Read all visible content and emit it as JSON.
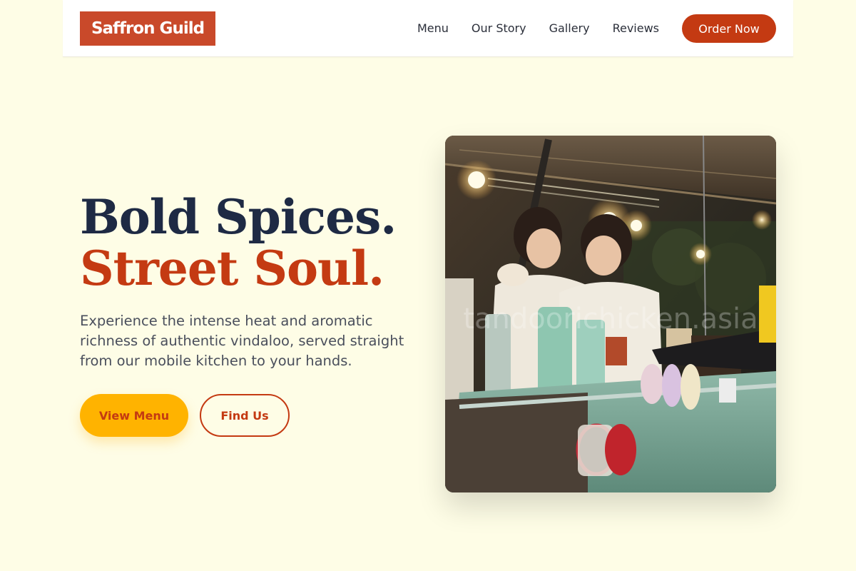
{
  "brand": {
    "name": "Saffron Guild"
  },
  "nav": {
    "links": [
      "Menu",
      "Our Story",
      "Gallery",
      "Reviews"
    ],
    "cta": "Order Now"
  },
  "hero": {
    "title_line1": "Bold Spices.",
    "title_line2": "Street Soul.",
    "description": "Experience the intense heat and aromatic richness of authentic vindaloo, served straight from our mobile kitchen to your hands.",
    "primary_button": "View Menu",
    "secondary_button": "Find Us",
    "image_watermark": "tandoorichicken.asia"
  },
  "colors": {
    "background": "#FEFDE6",
    "brand": "#C9492A",
    "accent": "#C43A12",
    "navy": "#1E2A44",
    "yellow": "#FFB300"
  }
}
